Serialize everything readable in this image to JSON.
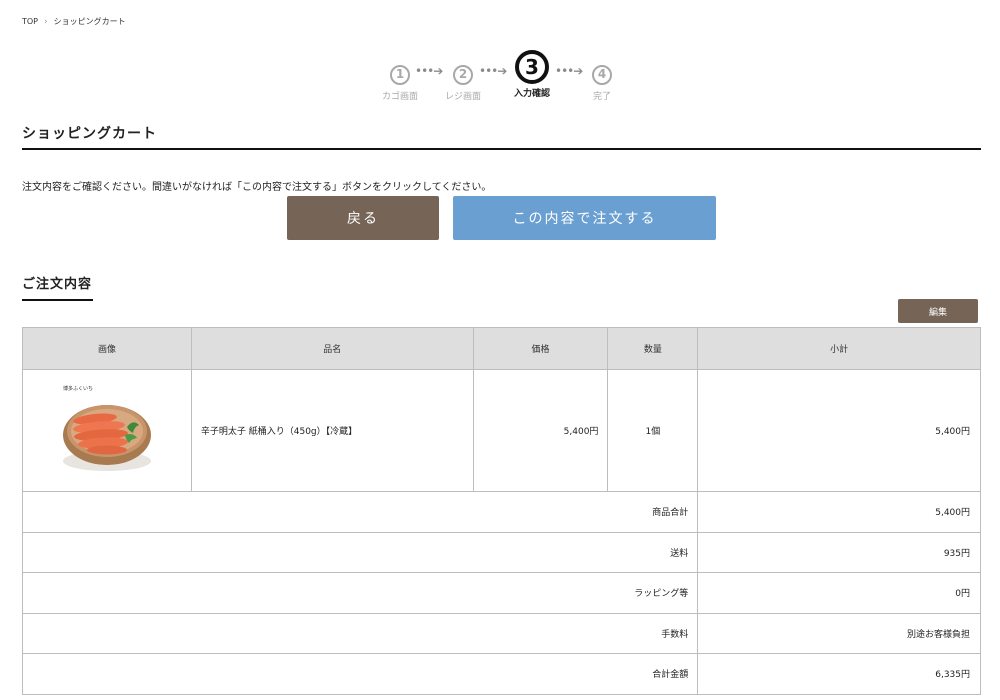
{
  "breadcrumb": {
    "home": "TOP",
    "current": "ショッピングカート"
  },
  "steps": [
    {
      "num": "1",
      "label": "カゴ画面"
    },
    {
      "num": "2",
      "label": "レジ画面"
    },
    {
      "num": "3",
      "label": "入力確認"
    },
    {
      "num": "4",
      "label": "完了"
    }
  ],
  "page_title": "ショッピングカート",
  "instruction": "注文内容をご確認ください。間違いがなければ「この内容で注文する」ボタンをクリックしてください。",
  "buttons": {
    "back": "戻る",
    "submit": "この内容で注文する",
    "edit": "編集"
  },
  "section_title": "ご注文内容",
  "table": {
    "headers": [
      "画像",
      "品名",
      "価格",
      "数量",
      "小計"
    ],
    "item": {
      "name": "辛子明太子 紙桶入り（450g）【冷蔵】",
      "price": "5,400円",
      "qty": "1個",
      "subtotal": "5,400円",
      "image_caption": "博多ふくいち"
    },
    "summary": [
      {
        "label": "商品合計",
        "value": "5,400円"
      },
      {
        "label": "送料",
        "value": "935円"
      },
      {
        "label": "ラッピング等",
        "value": "0円"
      },
      {
        "label": "手数料",
        "value": "別途お客様負担"
      },
      {
        "label": "合計金額",
        "value": "6,335円"
      }
    ]
  }
}
